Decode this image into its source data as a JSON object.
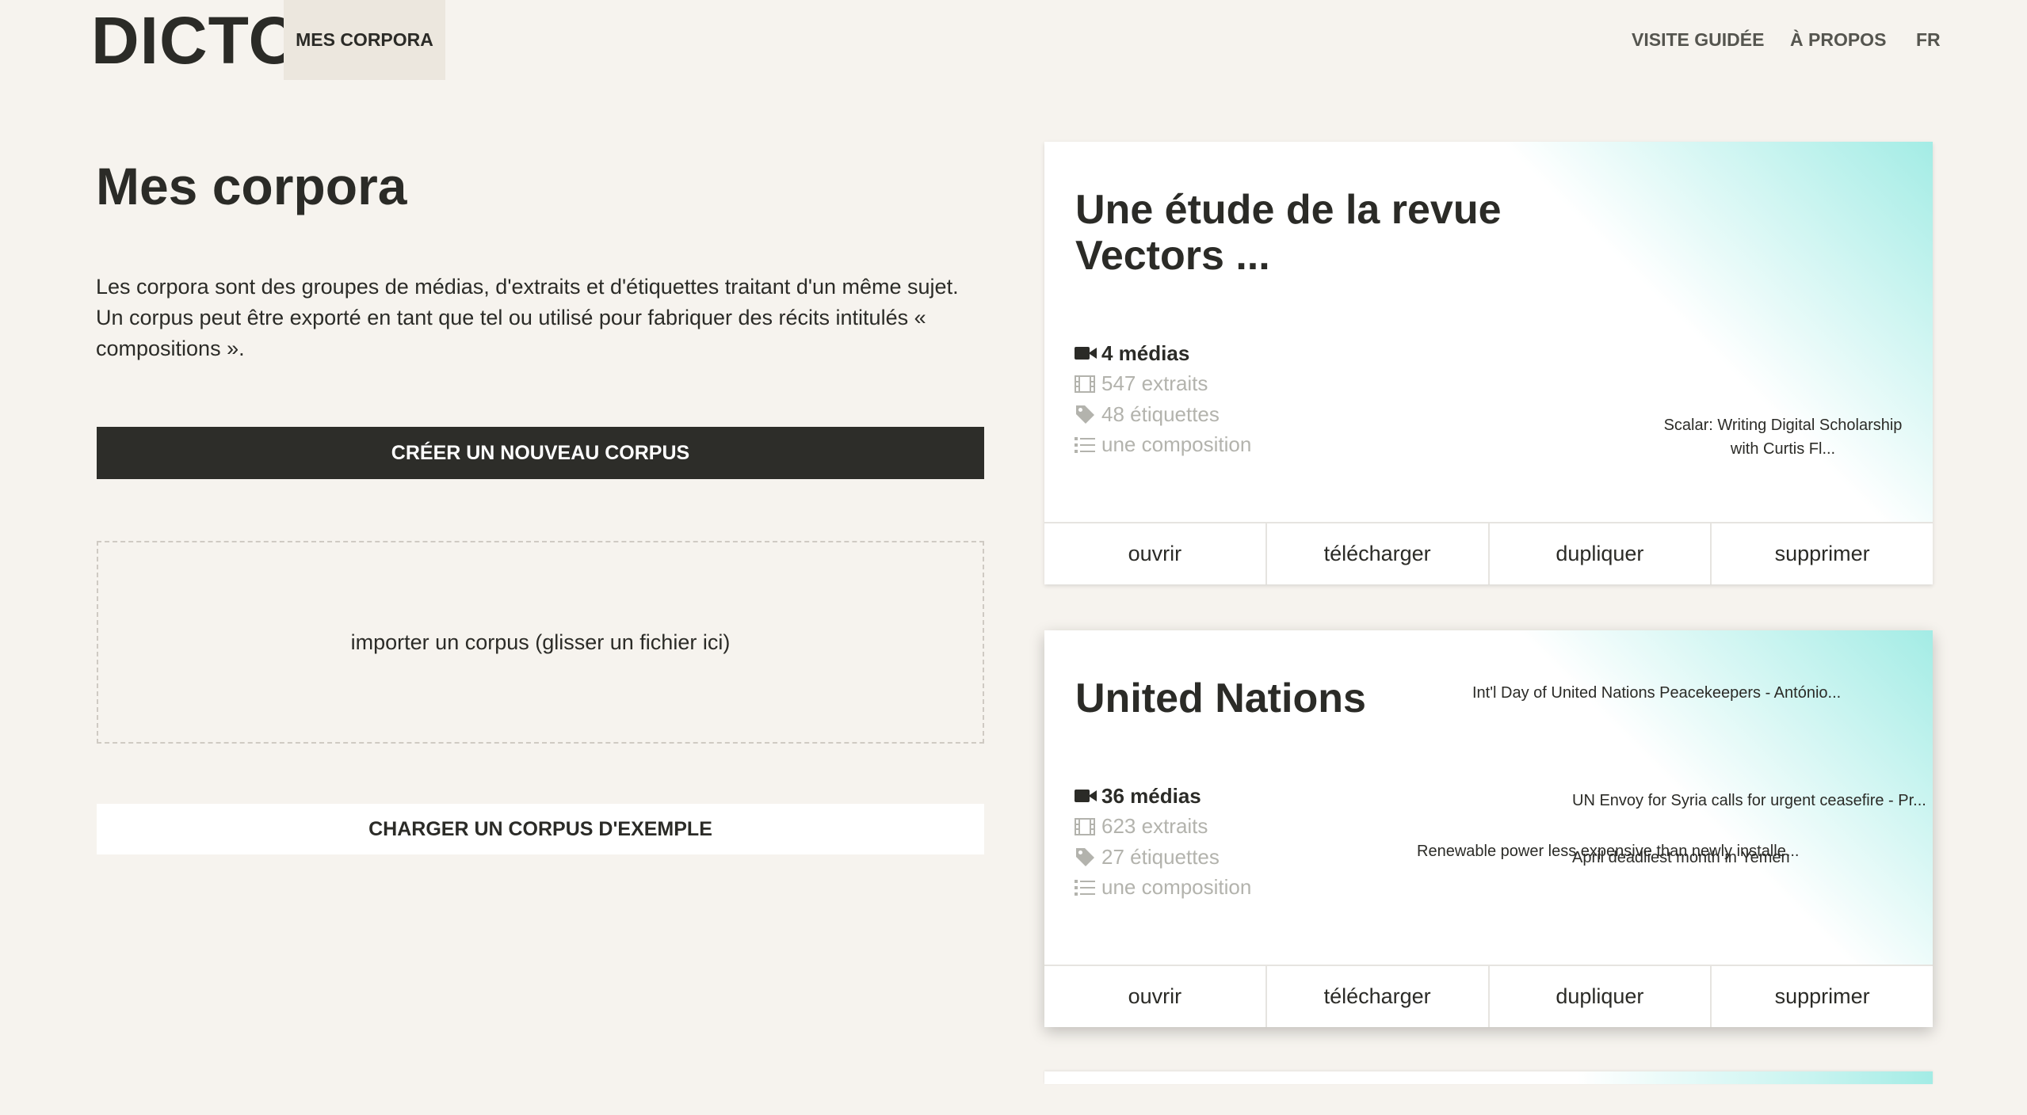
{
  "header": {
    "logo": "DICTO",
    "nav_active": "MES CORPORA",
    "nav_right": [
      "VISITE GUIDÉE",
      "À PROPOS",
      "FR"
    ]
  },
  "main": {
    "title": "Mes corpora",
    "intro": "Les corpora sont des groupes de médias, d'extraits et d'étiquettes traitant d'un même sujet. Un corpus peut être exporté en tant que tel ou utilisé pour fabriquer des récits intitulés « compositions ».",
    "create_button": "CRÉER UN NOUVEAU CORPUS",
    "dropzone": "importer un corpus (glisser un fichier ici)",
    "example_button": "CHARGER UN CORPUS D'EXEMPLE"
  },
  "cards": [
    {
      "title": "Une étude de la revue Vectors ...",
      "stats": {
        "medias": "4 médias",
        "extraits": "547 extraits",
        "etiquettes": "48 étiquettes",
        "compositions": "une composition"
      },
      "media_titles": [
        "Scalar: Writing Digital Scholarship with Curtis Fl..."
      ],
      "actions": [
        "ouvrir",
        "télécharger",
        "dupliquer",
        "supprimer"
      ]
    },
    {
      "title": "United Nations",
      "stats": {
        "medias": "36 médias",
        "extraits": "623 extraits",
        "etiquettes": "27 étiquettes",
        "compositions": "une composition"
      },
      "media_titles": [
        "Int'l Day of United Nations Peacekeepers - António...",
        "UN Envoy for Syria calls for urgent ceasefire - Pr...",
        "Renewable power less expensive than newly installe...",
        "April deadliest month in Yemen"
      ],
      "actions": [
        "ouvrir",
        "télécharger",
        "dupliquer",
        "supprimer"
      ]
    }
  ],
  "icons": {
    "medias": "video-camera-icon",
    "extraits": "film-icon",
    "etiquettes": "tag-icon",
    "compositions": "list-icon"
  },
  "colors": {
    "background": "#f6f3ee",
    "primary_button": "#2d2d29",
    "accent_gradient": "#a3ece5"
  }
}
